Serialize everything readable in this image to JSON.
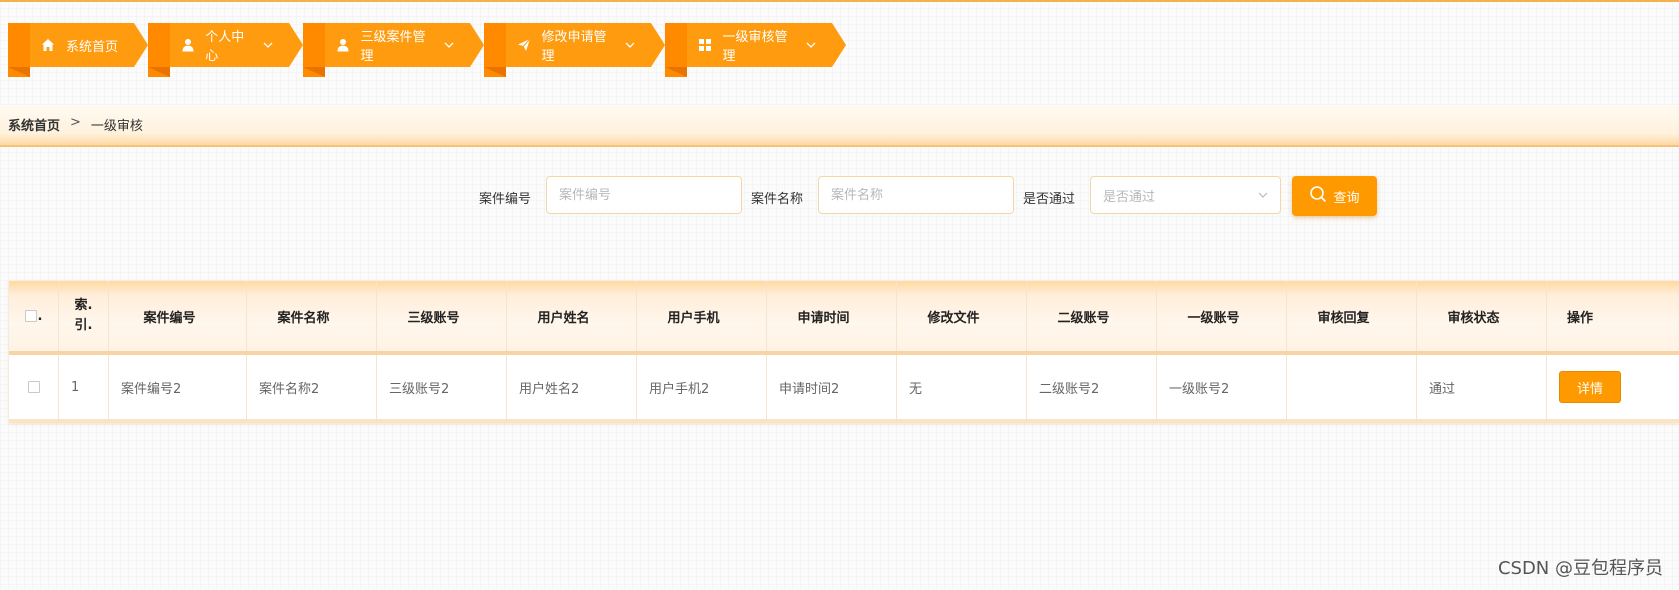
{
  "nav": [
    {
      "label": "系统首页",
      "icon": "home-icon",
      "has_caret": false
    },
    {
      "label": "个人中心",
      "icon": "user-icon",
      "has_caret": true
    },
    {
      "label": "三级案件管理",
      "icon": "user-icon",
      "has_caret": true
    },
    {
      "label": "修改申请管理",
      "icon": "send-icon",
      "has_caret": true
    },
    {
      "label": "一级审核管理",
      "icon": "grid-icon",
      "has_caret": true
    }
  ],
  "breadcrumb": {
    "home": "系统首页",
    "separator": ">",
    "current": "一级审核"
  },
  "search": {
    "case_no_label": "案件编号",
    "case_no_placeholder": "案件编号",
    "case_name_label": "案件名称",
    "case_name_placeholder": "案件名称",
    "passed_label": "是否通过",
    "passed_placeholder": "是否通过",
    "query_button": "查询"
  },
  "table": {
    "headers": {
      "select": ".",
      "index": "索.引.",
      "case_no": "案件编号",
      "case_name": "案件名称",
      "level3_account": "三级账号",
      "user_name": "用户姓名",
      "user_phone": "用户手机",
      "apply_time": "申请时间",
      "modify_file": "修改文件",
      "level2_account": "二级账号",
      "level1_account": "一级账号",
      "review_reply": "审核回复",
      "review_status": "审核状态",
      "actions": "操作"
    },
    "rows": [
      {
        "index": "1",
        "case_no": "案件编号2",
        "case_name": "案件名称2",
        "level3_account": "三级账号2",
        "user_name": "用户姓名2",
        "user_phone": "用户手机2",
        "apply_time": "申请时间2",
        "modify_file": "无",
        "level2_account": "二级账号2",
        "level1_account": "一级账号2",
        "review_reply": "",
        "review_status": "通过",
        "detail_button": "详情"
      }
    ]
  },
  "watermark": "CSDN @豆包程序员",
  "colors": {
    "accent": "#ff9900",
    "nav": "#ff9b0f",
    "nav_dark": "#e87300"
  }
}
